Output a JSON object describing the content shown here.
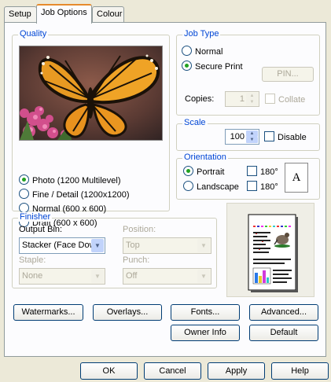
{
  "tabs": [
    {
      "label": "Setup"
    },
    {
      "label": "Job Options"
    },
    {
      "label": "Colour"
    }
  ],
  "quality": {
    "title": "Quality",
    "options": [
      {
        "label": "Photo (1200 Multilevel)",
        "selected": true
      },
      {
        "label": "Fine / Detail (1200x1200)",
        "selected": false
      },
      {
        "label": "Normal (600 x 600)",
        "selected": false
      },
      {
        "label": "Draft (600 x 600)",
        "selected": false
      }
    ]
  },
  "job_type": {
    "title": "Job Type",
    "normal_label": "Normal",
    "secure_label": "Secure Print",
    "pin_label": "PIN...",
    "copies_label": "Copies:",
    "copies_value": "1",
    "collate_label": "Collate"
  },
  "scale": {
    "title": "Scale",
    "value": "100",
    "disable_label": "Disable"
  },
  "orientation": {
    "title": "Orientation",
    "portrait_label": "Portrait",
    "landscape_label": "Landscape",
    "rotate_label": "180°",
    "preview_letter": "A"
  },
  "finisher": {
    "title": "Finisher",
    "output_bin_label": "Output Bin:",
    "output_bin_value": "Stacker (Face Dow",
    "position_label": "Position:",
    "position_value": "Top",
    "staple_label": "Staple:",
    "staple_value": "None",
    "punch_label": "Punch:",
    "punch_value": "Off"
  },
  "buttons": {
    "watermarks": "Watermarks...",
    "overlays": "Overlays...",
    "fonts": "Fonts...",
    "advanced": "Advanced...",
    "owner_info": "Owner Info",
    "default": "Default"
  },
  "footer": {
    "ok": "OK",
    "cancel": "Cancel",
    "apply": "Apply",
    "help": "Help"
  },
  "colors": {
    "group_title": "#0046D5",
    "tab_highlight": "#E68B2C",
    "radio_dot": "#21A121"
  }
}
